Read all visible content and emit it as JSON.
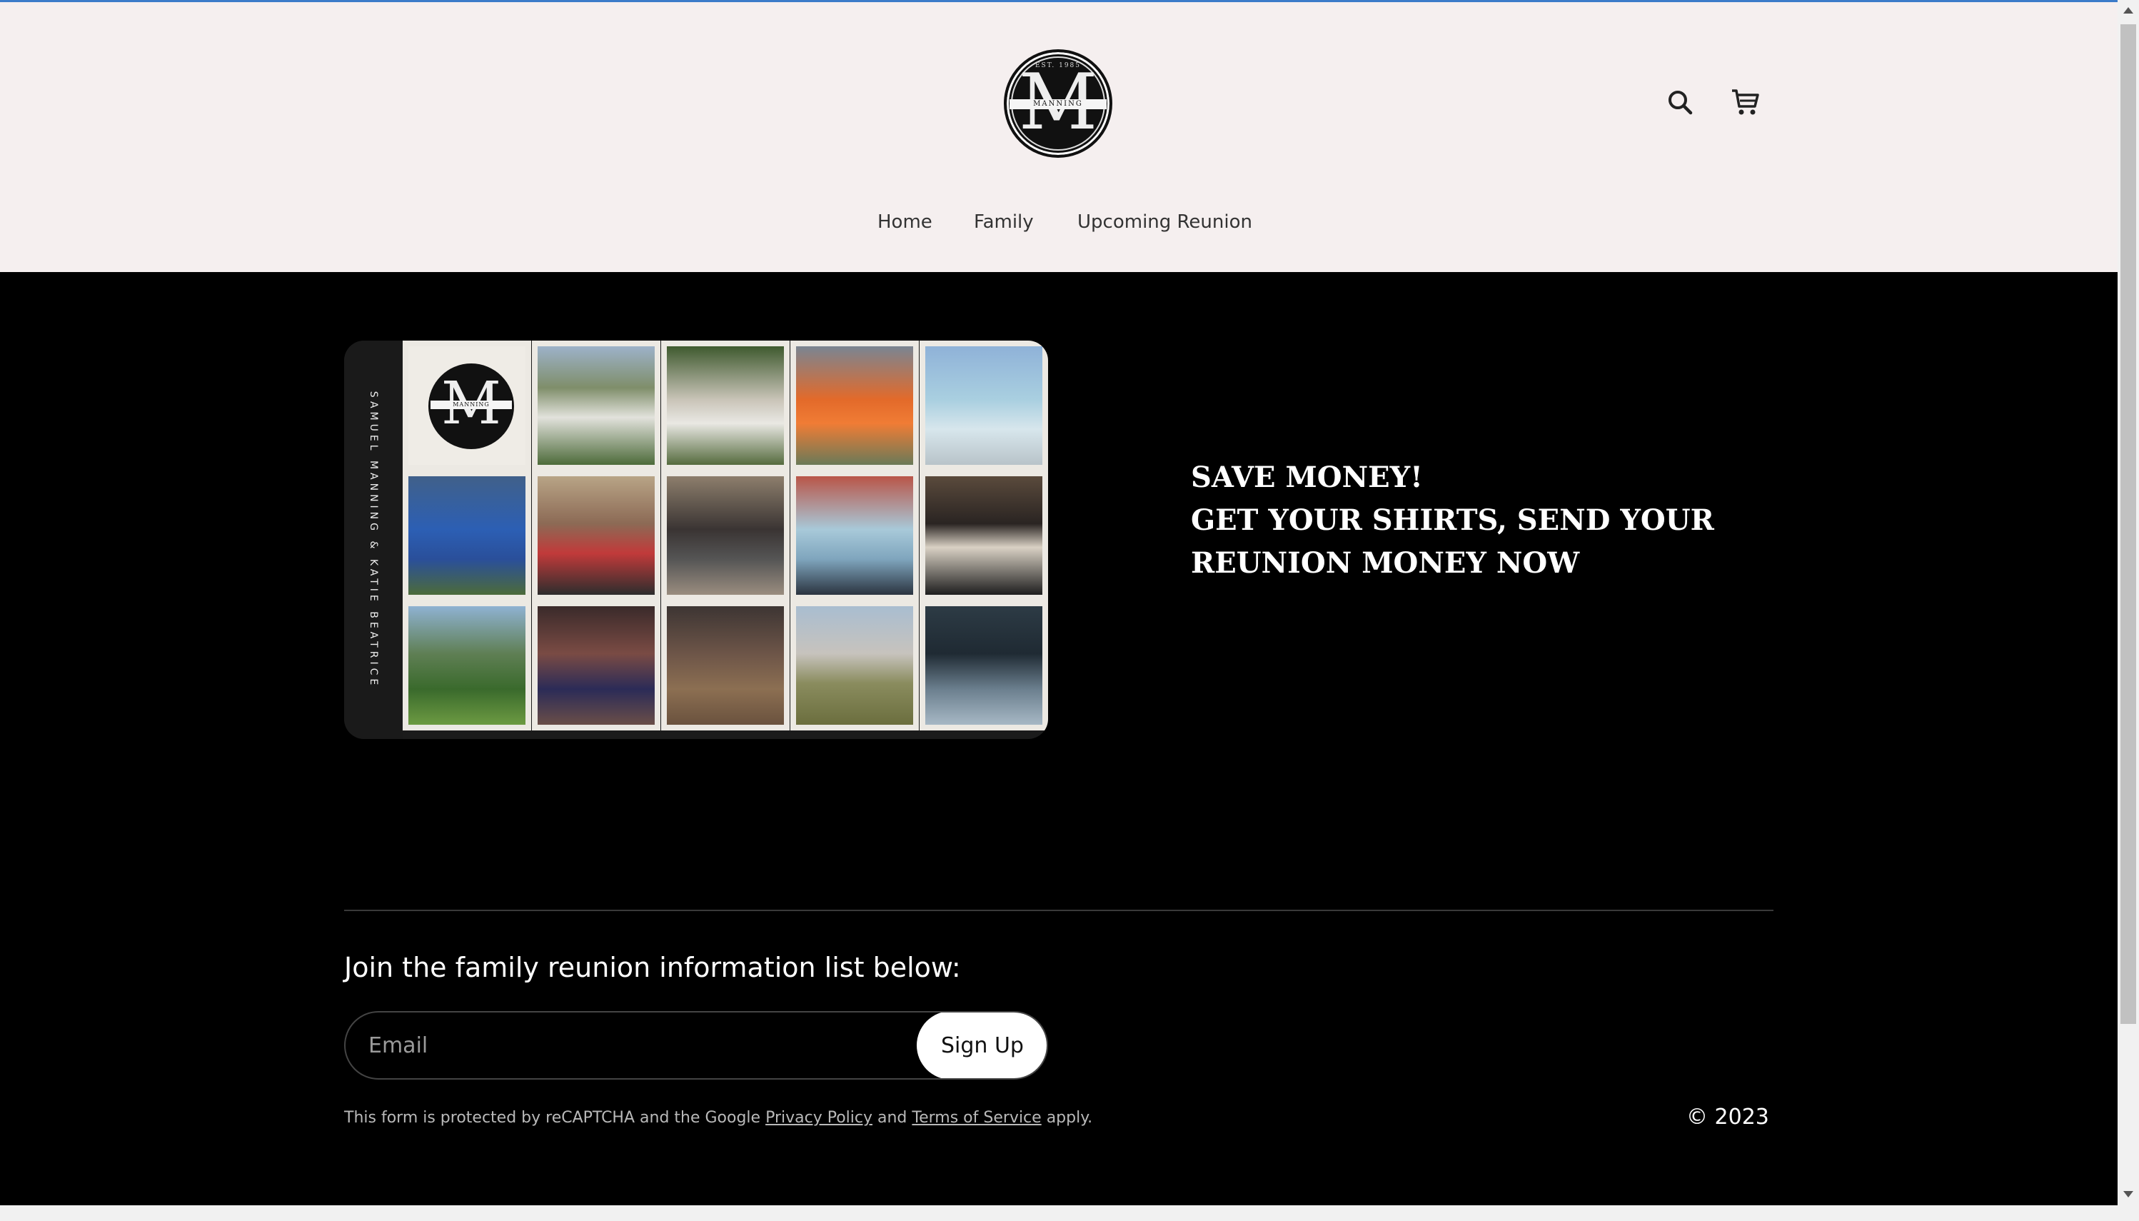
{
  "header": {
    "logo": {
      "letter": "M",
      "band_text": "MANNING",
      "est_text": "EST. 1985"
    },
    "icons": {
      "search": "search-icon",
      "cart": "cart-icon"
    },
    "nav": [
      {
        "label": "Home"
      },
      {
        "label": "Family"
      },
      {
        "label": "Upcoming Reunion"
      }
    ]
  },
  "hero": {
    "collage": {
      "side_text": "SAMUEL MANNING & KATIE BEATRICE",
      "logo_letter": "M",
      "logo_band": "MANNING"
    },
    "promo_lines": [
      "SAVE MONEY!",
      "GET YOUR SHIRTS, SEND YOUR",
      "REUNION MONEY NOW"
    ]
  },
  "signup": {
    "title": "Join the family reunion information list below:",
    "email_placeholder": "Email",
    "button_label": "Sign Up",
    "legal_prefix": "This form is protected by reCAPTCHA and the Google ",
    "privacy_label": "Privacy Policy",
    "legal_and": " and ",
    "terms_label": "Terms of Service",
    "legal_suffix": " apply."
  },
  "footer": {
    "copyright": "© 2023"
  },
  "colors": {
    "header_bg": "#f5efef",
    "main_bg": "#000000",
    "accent_line": "#3b7bc9"
  }
}
